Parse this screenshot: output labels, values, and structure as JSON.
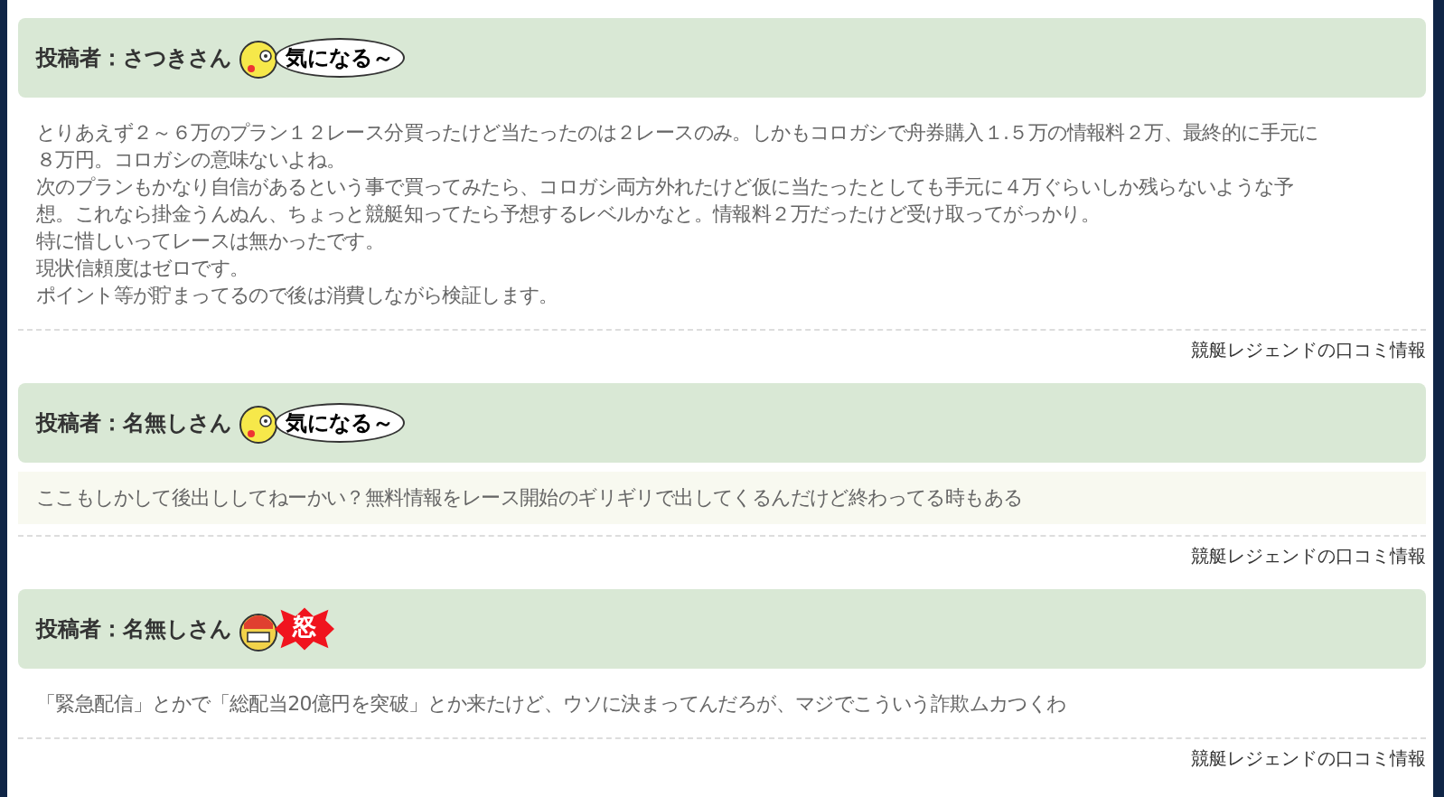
{
  "posts": [
    {
      "author_label": "投稿者：さつきさん",
      "stamp": {
        "kind": "curious",
        "label": "気になる～"
      },
      "highlighted_body": false,
      "body_lines": [
        "とりあえず２～６万のプラン１２レース分買ったけど当たったのは２レースのみ。しかもコロガシで舟券購入１.５万の情報料２万、最終的に手元に",
        "８万円。コロガシの意味ないよね。",
        "次のプランもかなり自信があるという事で買ってみたら、コロガシ両方外れたけど仮に当たったとしても手元に４万ぐらいしか残らないような予",
        "想。これなら掛金うんぬん、ちょっと競艇知ってたら予想するレベルかなと。情報料２万だったけど受け取ってがっかり。",
        "特に惜しいってレースは無かったです。",
        "現状信頼度はゼロです。",
        "ポイント等が貯まってるので後は消費しながら検証します。"
      ],
      "source": "競艇レジェンドの口コミ情報"
    },
    {
      "author_label": "投稿者：名無しさん",
      "stamp": {
        "kind": "curious",
        "label": "気になる～"
      },
      "highlighted_body": true,
      "body_lines": [
        "ここもしかして後出ししてねーかい？無料情報をレース開始のギリギリで出してくるんだけど終わってる時もある"
      ],
      "source": "競艇レジェンドの口コミ情報"
    },
    {
      "author_label": "投稿者：名無しさん",
      "stamp": {
        "kind": "angry",
        "label": "怒"
      },
      "highlighted_body": false,
      "body_lines": [
        "「緊急配信」とかで「総配当20億円を突破」とか来たけど、ウソに決まってんだろが、マジでこういう詐欺ムカつくわ"
      ],
      "source": "競艇レジェンドの口コミ情報"
    }
  ]
}
